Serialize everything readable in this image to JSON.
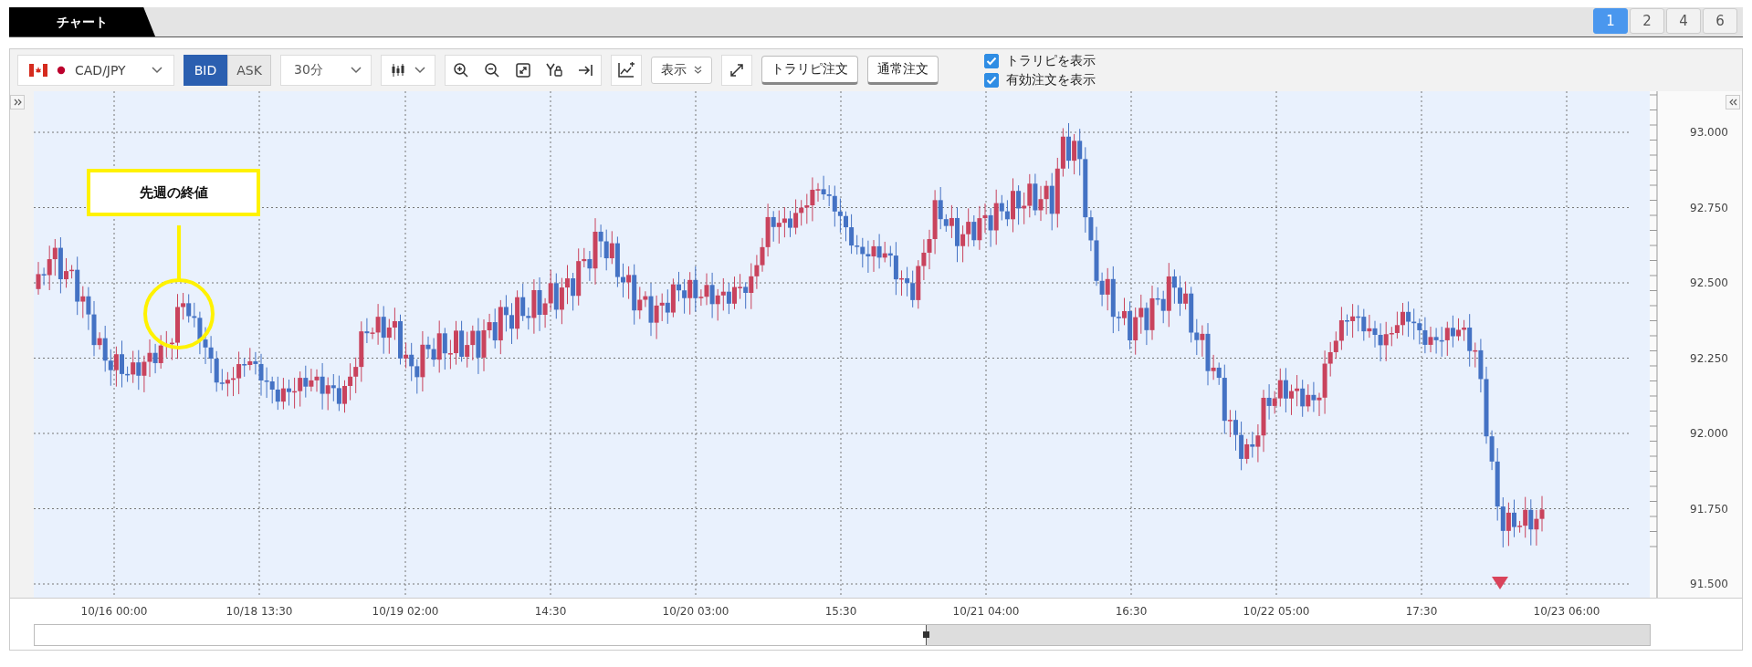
{
  "tab": {
    "label": "チャート"
  },
  "layout_buttons": [
    {
      "label": "1",
      "selected": true
    },
    {
      "label": "2",
      "selected": false
    },
    {
      "label": "4",
      "selected": false
    },
    {
      "label": "6",
      "selected": false
    }
  ],
  "toolbar": {
    "symbol": "CAD/JPY",
    "price_sides": [
      {
        "label": "BID",
        "selected": true
      },
      {
        "label": "ASK",
        "selected": false
      }
    ],
    "timeframe": "30分",
    "display_button": "表示",
    "order_buttons": [
      "トラリピ注文",
      "通常注文"
    ],
    "checkboxes": [
      {
        "label": "トラリピを表示",
        "checked": true
      },
      {
        "label": "有効注文を表示",
        "checked": true
      }
    ]
  },
  "chart": {
    "annotation": "先週の終値",
    "y_axis_labels": [
      "93.000",
      "92.750",
      "92.500",
      "92.250",
      "92.000",
      "91.750",
      "91.500"
    ],
    "x_axis_labels": [
      "10/16 00:00",
      "10/18 13:30",
      "10/19 02:00",
      "14:30",
      "10/20 03:00",
      "15:30",
      "10/21 04:00",
      "16:30",
      "10/22 05:00",
      "17:30",
      "10/23 06:00"
    ]
  }
}
